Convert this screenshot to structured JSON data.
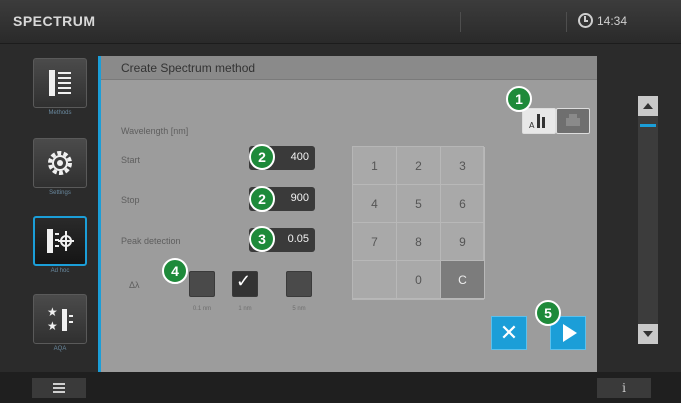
{
  "header": {
    "app_title": "SPECTRUM",
    "time": "14:34"
  },
  "sidebar": {
    "items": [
      {
        "label": "Methods",
        "icon": "methods-list-icon"
      },
      {
        "label": "Settings",
        "icon": "gear-icon"
      },
      {
        "label": "Ad hoc",
        "icon": "adhoc-spectrum-icon"
      },
      {
        "label": "AQA",
        "icon": "aqa-stars-icon"
      }
    ]
  },
  "panel": {
    "title": "Create Spectrum method",
    "wavelength_label": "Wavelength [nm]",
    "start_label": "Start",
    "start_value": "400",
    "stop_label": "Stop",
    "stop_value": "900",
    "peak_label": "Peak detection",
    "peak_value": "0.05",
    "step_label": "Δλ",
    "step_options": [
      {
        "label": "0.1 nm",
        "checked": false
      },
      {
        "label": "1 nm",
        "checked": true
      },
      {
        "label": "5 nm",
        "checked": false
      }
    ]
  },
  "keypad": {
    "keys": [
      "1",
      "2",
      "3",
      "4",
      "5",
      "6",
      "7",
      "8",
      "9",
      "",
      "0",
      "C"
    ]
  },
  "callouts": {
    "b1": "1",
    "b2a": "2",
    "b2b": "2",
    "b3": "3",
    "b4": "4",
    "b5": "5"
  },
  "colors": {
    "accent": "#1b9ed8",
    "badge": "#1e8a3a"
  }
}
